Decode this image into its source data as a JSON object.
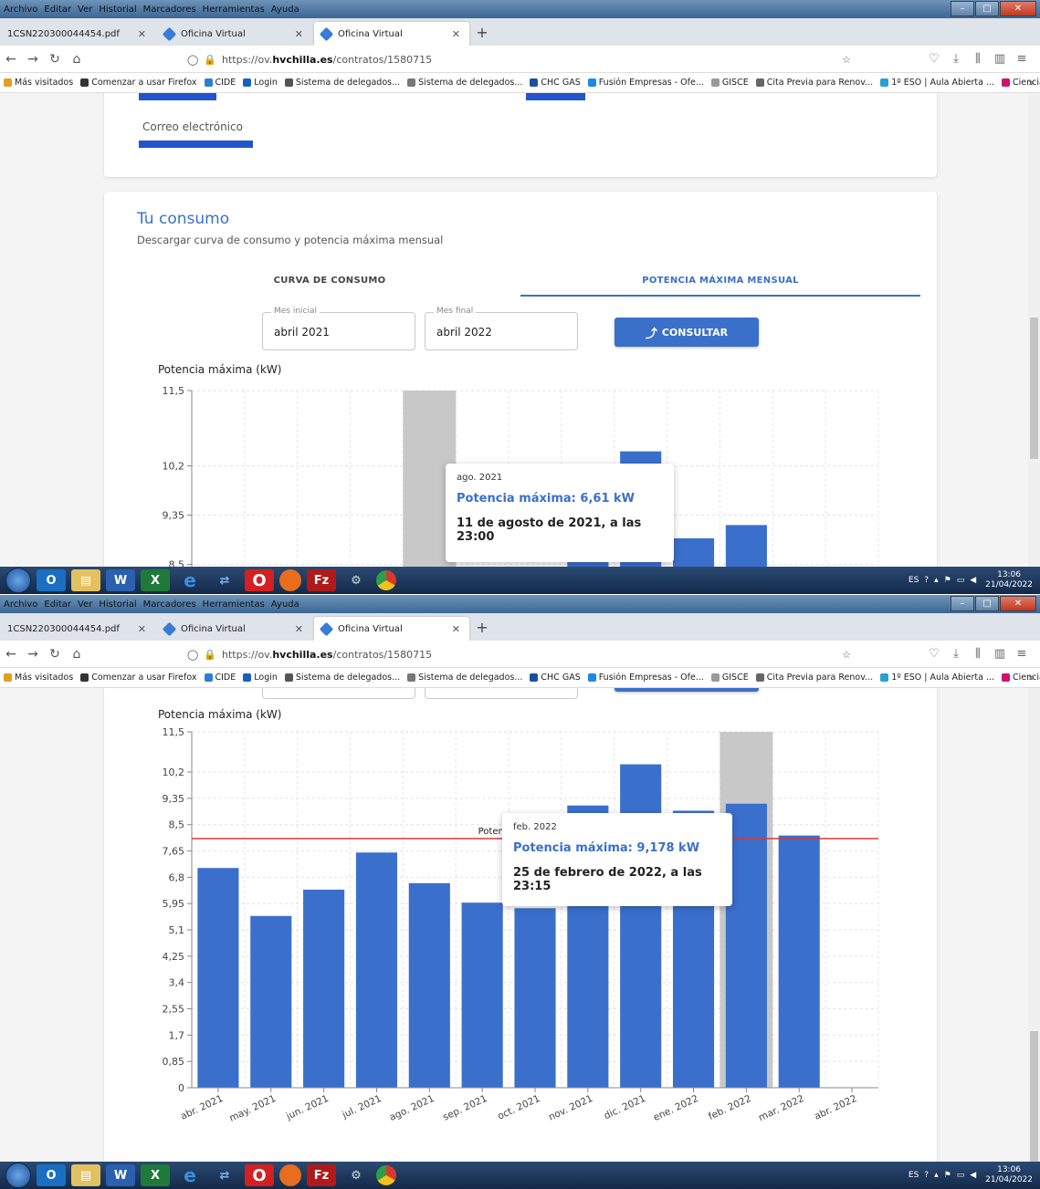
{
  "browser": {
    "menu": [
      "Archivo",
      "Editar",
      "Ver",
      "Historial",
      "Marcadores",
      "Herramientas",
      "Ayuda"
    ],
    "tabs": [
      {
        "label": "1CSN220300044454.pdf"
      },
      {
        "label": "Oficina Virtual"
      },
      {
        "label": "Oficina Virtual"
      }
    ],
    "url_prefix": "https://ov.",
    "url_domain": "hvchilla.es",
    "url_path": "/contratos/1580715",
    "bookmarks": [
      "Más visitados",
      "Comenzar a usar Firefox",
      "CIDE",
      "Login",
      "Sistema de delegados...",
      "Sistema de delegados...",
      "CHC GAS",
      "Fusión Empresas - Ofe...",
      "GISCE",
      "Cita Previa para Renov...",
      "1º ESO | Aula Abierta ...",
      "Ciencias Naturales y S..."
    ]
  },
  "page": {
    "email_label": "Correo electrónico",
    "section_title": "Tu consumo",
    "section_subtitle": "Descargar curva de consumo y potencia máxima mensual",
    "tab_consumo": "CURVA DE CONSUMO",
    "tab_potencia": "POTENCIA MÁXIMA MENSUAL",
    "mes_inicial_label": "Mes inicial",
    "mes_inicial_value": "abril 2021",
    "mes_final_label": "Mes final",
    "mes_final_value": "abril 2022",
    "consultar_label": "CONSULTAR"
  },
  "tooltip_top": {
    "month": "ago. 2021",
    "power": "Potencia máxima: 6,61 kW",
    "date": "11 de agosto de 2021, a las 23:00"
  },
  "tooltip_bottom": {
    "month": "feb. 2022",
    "power": "Potencia máxima: 9,178 kW",
    "date": "25 de febrero de 2022, a las 23:15"
  },
  "taskbar": {
    "lang": "ES",
    "time": "13:06",
    "date": "21/04/2022"
  },
  "chart_data": {
    "type": "bar",
    "ylabel": "Potencia máxima (kW)",
    "categories": [
      "abr. 2021",
      "may. 2021",
      "jun. 2021",
      "jul. 2021",
      "ago. 2021",
      "sep. 2021",
      "oct. 2021",
      "nov. 2021",
      "dic. 2021",
      "ene. 2022",
      "feb. 2022",
      "mar. 2022",
      "abr. 2022"
    ],
    "values": [
      7.1,
      5.55,
      6.4,
      7.6,
      6.61,
      5.98,
      5.8,
      9.12,
      10.45,
      8.95,
      9.178,
      8.15,
      null
    ],
    "ylim": [
      0,
      11.5
    ],
    "yticks": [
      "0",
      "0,85",
      "1,7",
      "2,55",
      "3,4",
      "4,25",
      "5,1",
      "5,95",
      "6,8",
      "7,65",
      "8,5",
      "9,35",
      "10,2",
      "11,5"
    ],
    "ytick_values": [
      0,
      0.85,
      1.7,
      2.55,
      3.4,
      4.25,
      5.1,
      5.95,
      6.8,
      7.65,
      8.5,
      9.35,
      10.2,
      11.5
    ],
    "reference_line": {
      "value": 8.05,
      "label": "Potencia contratada 8,05 kW",
      "color": "#d23a3a"
    },
    "bar_color": "#3b6fcc",
    "highlight_color": "#c8c8c8",
    "grid": true
  }
}
